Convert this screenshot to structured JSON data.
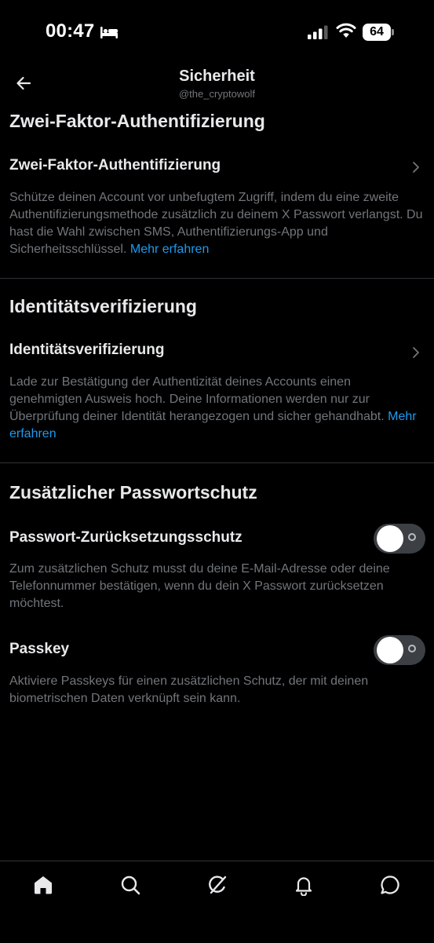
{
  "status_bar": {
    "time": "00:47",
    "battery": "64"
  },
  "header": {
    "title": "Sicherheit",
    "subtitle": "@the_cryptowolf"
  },
  "sections": {
    "two_factor": {
      "heading": "Zwei-Faktor-Authentifizierung",
      "row_title": "Zwei-Faktor-Authentifizierung",
      "description": "Schütze deinen Account vor unbefugtem Zugriff, indem du eine zweite Authentifizierungsmethode zusätzlich zu deinem X Passwort verlangst. Du hast die Wahl zwischen SMS, Authentifizierungs-App und Sicherheitsschlüssel.",
      "link": "Mehr erfahren"
    },
    "identity": {
      "heading": "Identitätsverifizierung",
      "row_title": "Identitätsverifizierung",
      "description": "Lade zur Bestätigung der Authentizität deines Accounts einen genehmigten Ausweis hoch. Deine Informationen werden nur zur Überprüfung deiner Identität herangezogen und sicher gehandhabt.",
      "link": "Mehr erfahren"
    },
    "password_protection": {
      "heading": "Zusätzlicher Passwortschutz",
      "reset_protection": {
        "title": "Passwort-Zurücksetzungsschutz",
        "description": "Zum zusätzlichen Schutz musst du deine E-Mail-Adresse oder deine Telefonnummer bestätigen, wenn du dein X Passwort zurücksetzen möchtest.",
        "enabled": false
      },
      "passkey": {
        "title": "Passkey",
        "description": "Aktiviere Passkeys für einen zusätzlichen Schutz, der mit deinen biometrischen Daten verknüpft sein kann.",
        "enabled": false
      }
    }
  },
  "bottom_nav": [
    {
      "icon": "home-icon",
      "active": true
    },
    {
      "icon": "search-icon",
      "active": false
    },
    {
      "icon": "grok-icon",
      "active": false
    },
    {
      "icon": "bell-icon",
      "active": false
    },
    {
      "icon": "messages-icon",
      "active": false
    }
  ],
  "colors": {
    "background": "#000000",
    "text_primary": "#e7e9ea",
    "text_secondary": "#71767b",
    "link": "#1d9bf0",
    "divider": "#2f3336",
    "toggle_track": "#3c4045"
  }
}
